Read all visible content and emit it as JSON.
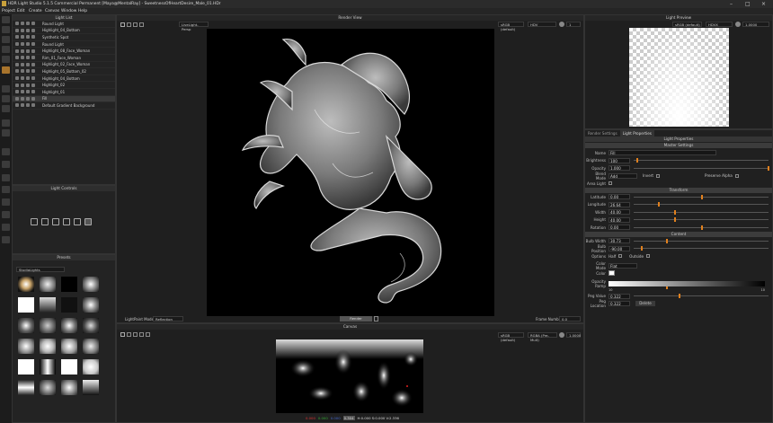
{
  "window": {
    "title": "HDR Light Studio 5.1.5 Commercial Permanent [Maya@MentalRay] - SweetnessOfHeartDesire_Male_01.HDr"
  },
  "menu": [
    "Project",
    "Edit",
    "Create",
    "Canvas",
    "Window",
    "Help"
  ],
  "light_list": {
    "title": "Light List",
    "items": [
      "Round Light",
      "Highlight_04_Bottom",
      "Synthetic Spot",
      "Round Light",
      "Highlight_08_Face_Woman",
      "Rim_01_Face_Woman",
      "Highlight_02_Face_Woman",
      "Highlight_05_Bottom_02",
      "Highlight_04_Bottom",
      "Highlight_02",
      "Highlight_01",
      "Fill",
      "Default Gradient Background"
    ],
    "selected_index": 11
  },
  "light_controls": {
    "title": "Light Controls"
  },
  "presets": {
    "title": "Presets",
    "dropdown": "StudioLights"
  },
  "render_view": {
    "title": "Render View",
    "mode": "LiveLight-Persp",
    "color_space": "sRGB (default)",
    "display": "HDV",
    "lightpaint_label": "LightPaint Mode",
    "lightpaint_value": "Reflection",
    "frame_label": "Frame Number",
    "frame_value": "0.0",
    "render_btn": "Render",
    "exposure_value": "1"
  },
  "canvas": {
    "title": "Canvas",
    "color_space": "sRGB (default)",
    "format": "RGBA (Pre-Mult)",
    "exposure": "1.0000",
    "status_r": "0.000",
    "status_g": "0.000",
    "status_b": "0.000",
    "status_a": "0.304",
    "status_hsv": "H:0.000 S:0.000 V:2.336"
  },
  "light_preview": {
    "title": "Light Preview",
    "color_space": "sRGB (default)",
    "display": "HDVX",
    "value": "1.0000"
  },
  "props": {
    "tab1": "Render Settings",
    "tab2": "Light Properties",
    "header": "Light Properties",
    "master": "Master Settings",
    "name_label": "Name",
    "name": "Fill",
    "brightness_label": "Brightness",
    "brightness": "100",
    "brightness_pos": 0.02,
    "opacity_label": "Opacity",
    "opacity": "1.000",
    "opacity_pos": 0.99,
    "blend_label": "Blend Mode",
    "blend": "Add",
    "invert": "Invert",
    "preserve_alpha": "Preserve Alpha",
    "area_light": "Area Light",
    "transform": "Transform",
    "latitude_label": "Latitude",
    "latitude": "0.00",
    "latitude_pos": 0.5,
    "longitude_label": "Longitude",
    "longitude": "26.64",
    "longitude_pos": 0.18,
    "width_label": "Width",
    "width": "40.00",
    "width_pos": 0.3,
    "height_label": "Height",
    "height": "40.00",
    "height_pos": 0.3,
    "rotation_label": "Rotation",
    "rotation": "0.00",
    "rotation_pos": 0.5,
    "content": "Content",
    "bulbw_label": "Bulb Width",
    "bulbw": "30.73",
    "bulbw_pos": 0.24,
    "bulbp_label": "Bulb Position",
    "bulbp": "-90.00",
    "bulbp_pos": 0.05,
    "options_label": "Options",
    "half": "Half",
    "outside": "Outside",
    "colormode_label": "Color Mode",
    "colormode": "Flat",
    "color_label": "Color",
    "opacity_ramp_label": "Opacity Ramp",
    "ramp_left": "10",
    "ramp_right": "10",
    "peg_value_label": "Peg Value",
    "peg_value": "0.322",
    "peg_value_pos": 0.33,
    "peg_loc_label": "Peg Location",
    "peg_loc": "0.322",
    "peg_loc_pos": 0.33,
    "delete": "Delete"
  }
}
